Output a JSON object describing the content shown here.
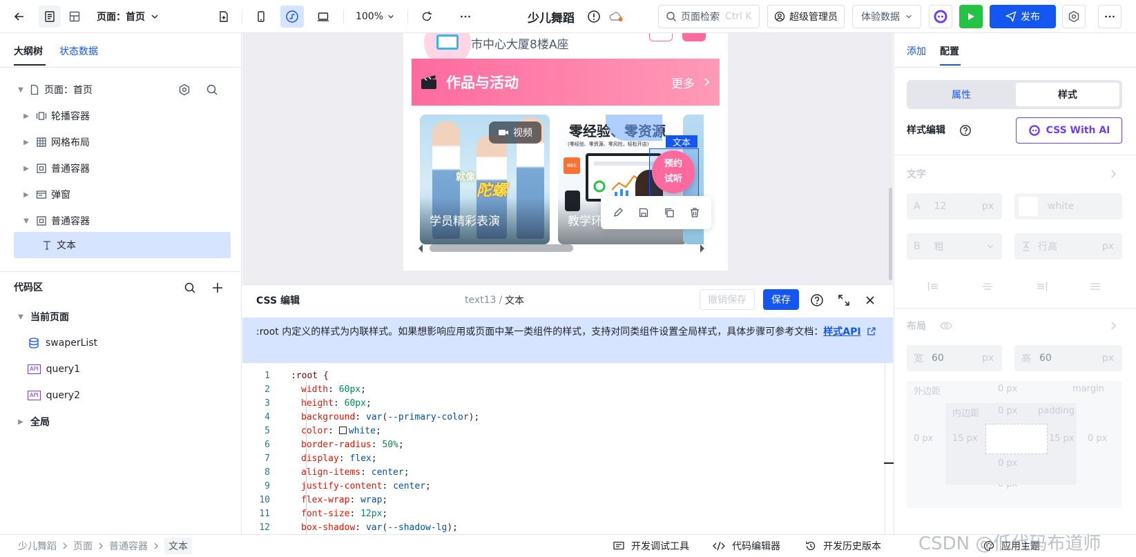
{
  "topbar": {
    "page_selector": "页面：首页",
    "zoom": "100%",
    "app_title": "少儿舞蹈",
    "search_placeholder": "页面检索",
    "search_shortcut": "Ctrl K",
    "user_role": "超级管理员",
    "data_mode": "体验数据",
    "publish_label": "发布"
  },
  "outline": {
    "tabs": [
      "大纲树",
      "状态数据"
    ],
    "items": [
      {
        "label": "页面：首页"
      },
      {
        "label": "轮播容器"
      },
      {
        "label": "网格布局"
      },
      {
        "label": "普通容器"
      },
      {
        "label": "弹窗"
      },
      {
        "label": "普通容器"
      },
      {
        "label": "文本"
      }
    ]
  },
  "code_area": {
    "title": "代码区",
    "current_page": "当前页面",
    "items": [
      "swaperList",
      "query1",
      "query2"
    ],
    "api_badge": "API",
    "global": "全局"
  },
  "preview": {
    "address": "市中心大厦8楼A座",
    "section_title": "作品与活动",
    "more": "更多",
    "card1": {
      "badge": "视频",
      "caption": "学员精彩表演",
      "art_text1": "就像",
      "art_text2": "陀螺"
    },
    "card2": {
      "headline": "零经验、零资源",
      "sub": "(零经验、零资源、零风险，轻松开店)",
      "caption": "教学环境",
      "tag": "BBE"
    },
    "text_tag": "文本",
    "circle_text": "预约\n试听"
  },
  "css_editor": {
    "title": "CSS 编辑",
    "target_id": "text13",
    "target_name": "文本",
    "undo_save": "撤销保存",
    "save": "保存",
    "notice": ":root 内定义的样式为内联样式。如果想影响应用或页面中某一类组件的样式，支持对同类组件设置全局样式，具体步骤可参考文档：",
    "notice_link": "样式API",
    "code": [
      {
        "n": "1",
        "sel": ":root {"
      },
      {
        "n": "2",
        "prop": "width",
        "val": "60px"
      },
      {
        "n": "3",
        "prop": "height",
        "val": "60px"
      },
      {
        "n": "4",
        "prop": "background",
        "fn": "var",
        "arg": "--primary-color"
      },
      {
        "n": "5",
        "prop": "color",
        "val": "white",
        "swatch": true
      },
      {
        "n": "6",
        "prop": "border-radius",
        "val": "50%"
      },
      {
        "n": "7",
        "prop": "display",
        "val": "flex"
      },
      {
        "n": "8",
        "prop": "align-items",
        "val": "center"
      },
      {
        "n": "9",
        "prop": "justify-content",
        "val": "center"
      },
      {
        "n": "10",
        "prop": "flex-wrap",
        "val": "wrap"
      },
      {
        "n": "11",
        "prop": "font-size",
        "val": "12px"
      },
      {
        "n": "12",
        "prop": "box-shadow",
        "fn": "var",
        "arg": "--shadow-lg"
      }
    ]
  },
  "config": {
    "tabs": [
      "添加",
      "配置"
    ],
    "subtabs": [
      "属性",
      "样式"
    ],
    "style_edit_label": "样式编辑",
    "css_ai": "CSS With AI",
    "text_section": "文字",
    "font_size_prefix": "A",
    "font_size": "12",
    "unit_px": "px",
    "color_value": "white",
    "weight_prefix": "B",
    "weight": "粗",
    "line_height_placeholder": "行高",
    "layout_section": "布局",
    "width_label": "宽",
    "width_value": "60",
    "height_label": "高",
    "height_value": "60",
    "margin_label": "外边距",
    "margin_en": "margin",
    "padding_label": "内边距",
    "padding_en": "padding",
    "zero_px": "0 px",
    "fifteen_px": "15 px"
  },
  "statusbar": {
    "breadcrumb": [
      "少儿舞蹈",
      "页面",
      "普通容器",
      "文本"
    ],
    "dev_tools": "开发调试工具",
    "code_editor": "代码编辑器",
    "history": "开发历史版本",
    "theme": "应用主题",
    "watermark": "CSDN @低代码布道师"
  },
  "colors": {
    "accent": "#1456f0",
    "pink": "#ff6a9e",
    "green": "#23c343",
    "notice_bg": "#d6e4ff",
    "selected_bg": "#d6e4ff"
  }
}
